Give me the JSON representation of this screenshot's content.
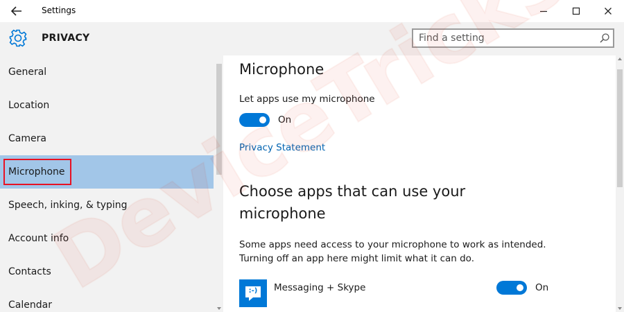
{
  "window": {
    "title": "Settings",
    "back_icon": "arrow-left-icon",
    "minimize_icon": "minimize-icon",
    "maximize_icon": "maximize-icon",
    "close_icon": "close-icon"
  },
  "header": {
    "icon": "gear-icon",
    "title": "PRIVACY",
    "search": {
      "placeholder": "Find a setting",
      "icon": "search-icon"
    }
  },
  "sidebar": {
    "selected": "Microphone",
    "items": [
      {
        "label": "General"
      },
      {
        "label": "Location"
      },
      {
        "label": "Camera"
      },
      {
        "label": "Microphone"
      },
      {
        "label": "Speech, inking, & typing"
      },
      {
        "label": "Account info"
      },
      {
        "label": "Contacts"
      },
      {
        "label": "Calendar"
      }
    ]
  },
  "main": {
    "title": "Microphone",
    "setting_label": "Let apps use my microphone",
    "toggle_state": "On",
    "toggle_on": true,
    "privacy_link": "Privacy Statement",
    "section_title": "Choose apps that can use your microphone",
    "section_desc": "Some apps need access to your microphone to work as intended. Turning off an app here might limit what it can do.",
    "apps": [
      {
        "name": "Messaging + Skype",
        "toggle_state": "On",
        "toggle_on": true,
        "icon": "messaging-icon",
        "icon_text": ":-)"
      }
    ]
  },
  "watermark": {
    "text": "DeviceTricks"
  },
  "colors": {
    "accent": "#0078d7",
    "selected_bg": "#a2c6e8",
    "highlight_box": "#e81123",
    "link": "#0063b1",
    "sidebar_bg": "#f2f2f2"
  }
}
